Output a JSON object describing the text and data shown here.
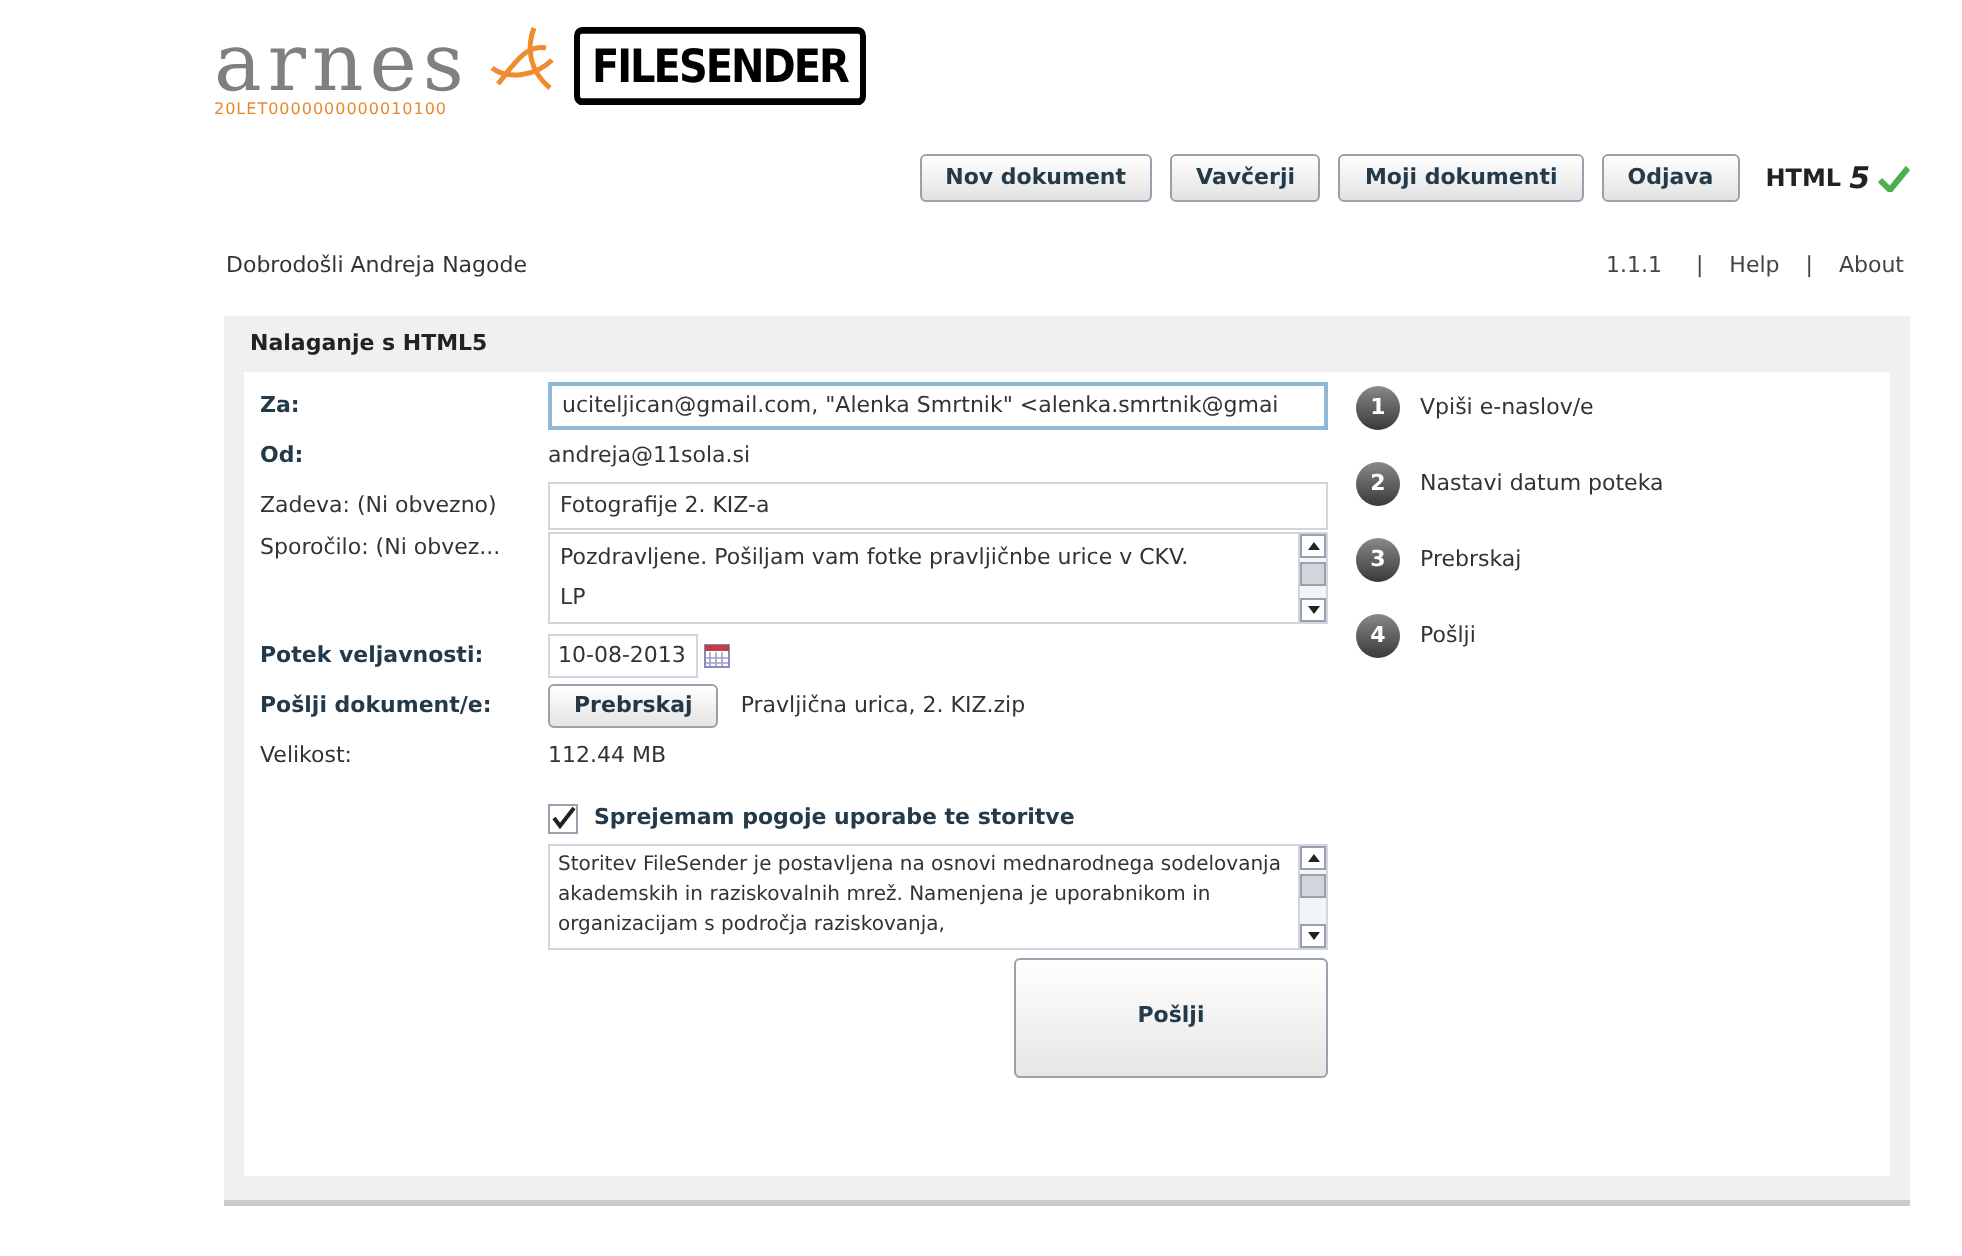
{
  "logo": {
    "name": "arnes",
    "tagline": "20LET0000000000010100",
    "product": "FILESENDER"
  },
  "nav": [
    "Nov dokument",
    "Vavčerji",
    "Moji dokumenti",
    "Odjava"
  ],
  "html5": {
    "label": "HTML",
    "mark": "5"
  },
  "welcome": "Dobrodošli Andreja Nagode",
  "links": [
    {
      "kind": "text",
      "label": "1.1.1"
    },
    {
      "kind": "sep",
      "label": "|"
    },
    {
      "kind": "link",
      "label": "Help"
    },
    {
      "kind": "sep",
      "label": "|"
    },
    {
      "kind": "link",
      "label": "About"
    }
  ],
  "panel": {
    "title": "Nalaganje s HTML5"
  },
  "form": [
    {
      "kind": "input",
      "label": "Za:",
      "bold": true,
      "value": "uciteljican@gmail.com, \"Alenka Smrtnik\" <alenka.smrtnik@gmai"
    },
    {
      "kind": "text",
      "label": "Od:",
      "bold": true,
      "value": "andreja@11sola.si"
    },
    {
      "kind": "input",
      "label": "Zadeva: (Ni obvezno)",
      "bold": false,
      "value": "Fotografije 2. KIZ-a"
    },
    {
      "kind": "textarea",
      "label": "Sporočilo: (Ni obvez...",
      "bold": false,
      "lines": [
        "Pozdravljene. Pošiljam vam fotke pravljičnbe urice v CKV.",
        "LP"
      ]
    },
    {
      "kind": "date",
      "label": "Potek veljavnosti:",
      "bold": true,
      "value": "10-08-2013"
    },
    {
      "kind": "file",
      "label": "Pošlji dokument/e:",
      "bold": true,
      "button": "Prebrskaj",
      "value": "Pravljična urica, 2. KIZ.zip"
    },
    {
      "kind": "text",
      "label": "Velikost:",
      "bold": false,
      "value": "112.44 MB"
    }
  ],
  "terms": {
    "checked": true,
    "label": "Sprejemam pogoje uporabe te storitve",
    "text": "Storitev FileSender je postavljena na osnovi  mednarodnega sodelovanja akademskih in raziskovalnih mrež.  Namenjena je uporabnikom in organizacijam s področja raziskovanja,"
  },
  "send": "Pošlji",
  "steps": [
    {
      "number": "1",
      "label": "Vpiši e-naslov/e"
    },
    {
      "number": "2",
      "label": "Nastavi datum poteka"
    },
    {
      "number": "3",
      "label": "Prebrskaj"
    },
    {
      "number": "4",
      "label": "Pošlji"
    }
  ]
}
